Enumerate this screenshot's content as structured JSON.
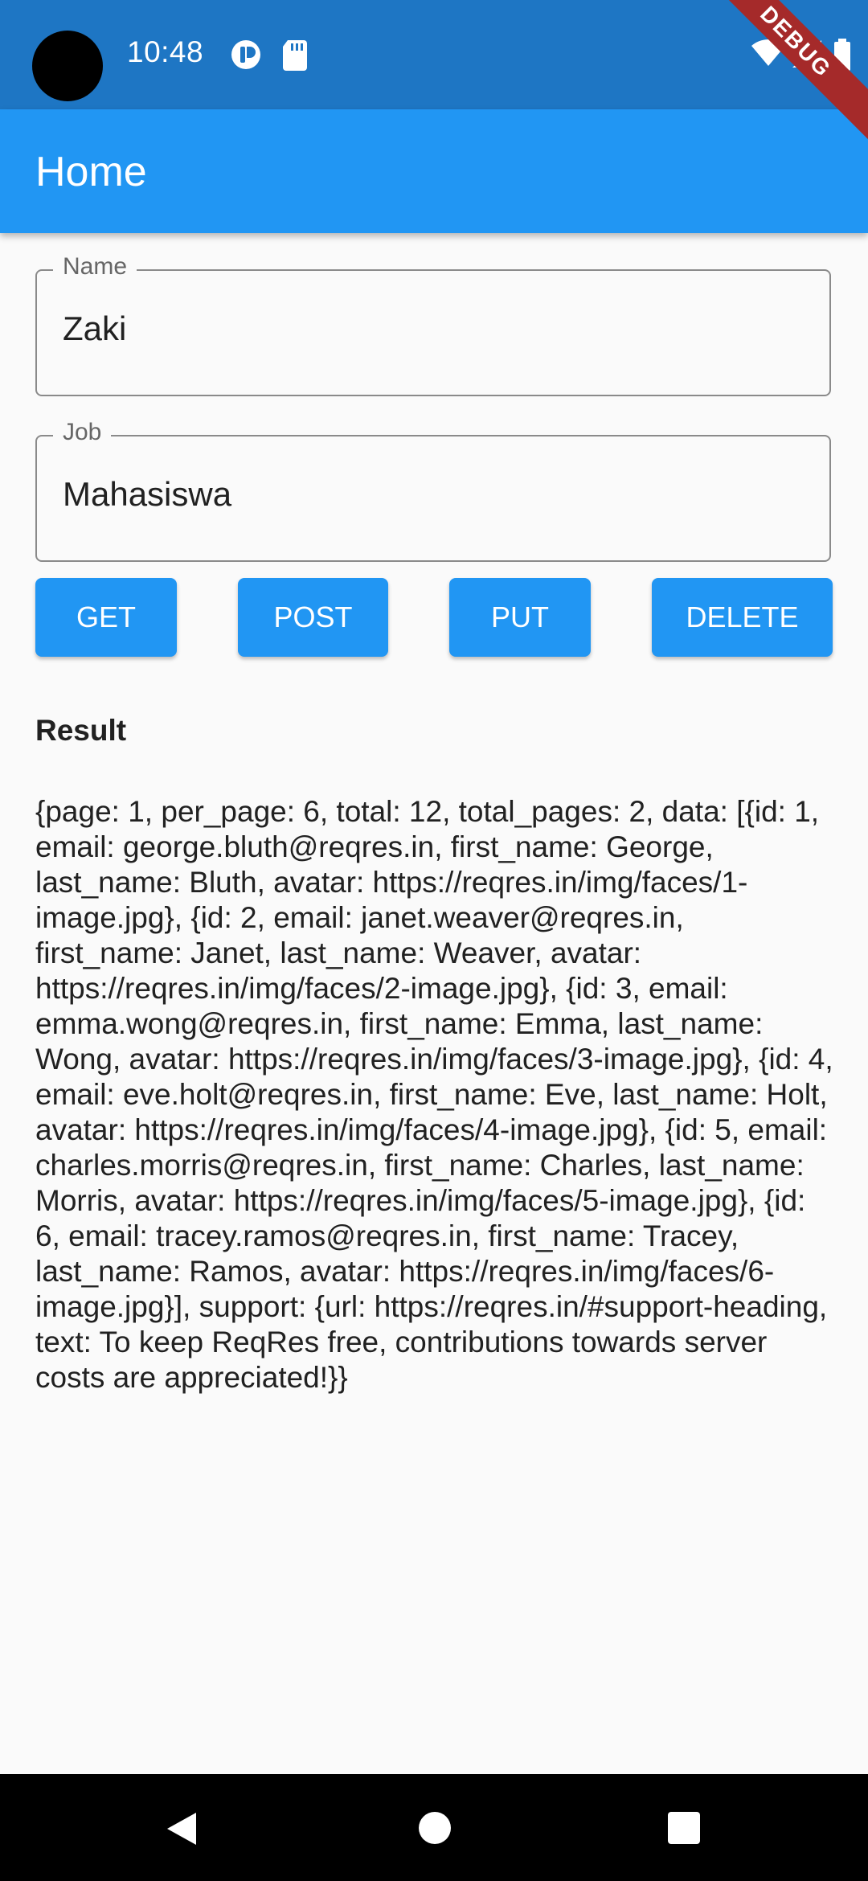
{
  "status_bar": {
    "time": "10:48",
    "icons": [
      "camera-cutout",
      "notification-icon",
      "sd-card-icon",
      "wifi-icon",
      "signal-icon",
      "battery-icon"
    ]
  },
  "debug_banner": "DEBUG",
  "app_bar": {
    "title": "Home"
  },
  "form": {
    "name": {
      "label": "Name",
      "value": "Zaki"
    },
    "job": {
      "label": "Job",
      "value": "Mahasiswa"
    }
  },
  "buttons": {
    "get": "GET",
    "post": "POST",
    "put": "PUT",
    "delete": "DELETE"
  },
  "result": {
    "heading": "Result",
    "text": "{page: 1, per_page: 6, total: 12, total_pages: 2, data: [{id: 1, email: george.bluth@reqres.in, first_name: George, last_name: Bluth, avatar: https://reqres.in/img/faces/1-image.jpg}, {id: 2, email: janet.weaver@reqres.in, first_name: Janet, last_name: Weaver, avatar: https://reqres.in/img/faces/2-image.jpg}, {id: 3, email: emma.wong@reqres.in, first_name: Emma, last_name: Wong, avatar: https://reqres.in/img/faces/3-image.jpg}, {id: 4, email: eve.holt@reqres.in, first_name: Eve, last_name: Holt, avatar: https://reqres.in/img/faces/4-image.jpg}, {id: 5, email: charles.morris@reqres.in, first_name: Charles, last_name: Morris, avatar: https://reqres.in/img/faces/5-image.jpg}, {id: 6, email: tracey.ramos@reqres.in, first_name: Tracey, last_name: Ramos, avatar: https://reqres.in/img/faces/6-image.jpg}], support: {url: https://reqres.in/#support-heading, text: To keep ReqRes free, contributions towards server costs are appreciated!}}"
  },
  "colors": {
    "status_bar": "#1e76c4",
    "app_bar": "#2196f3",
    "button": "#2196f3",
    "background": "#fafafa"
  },
  "nav_bar": {
    "icons": [
      "back-icon",
      "home-icon",
      "recents-icon"
    ]
  }
}
